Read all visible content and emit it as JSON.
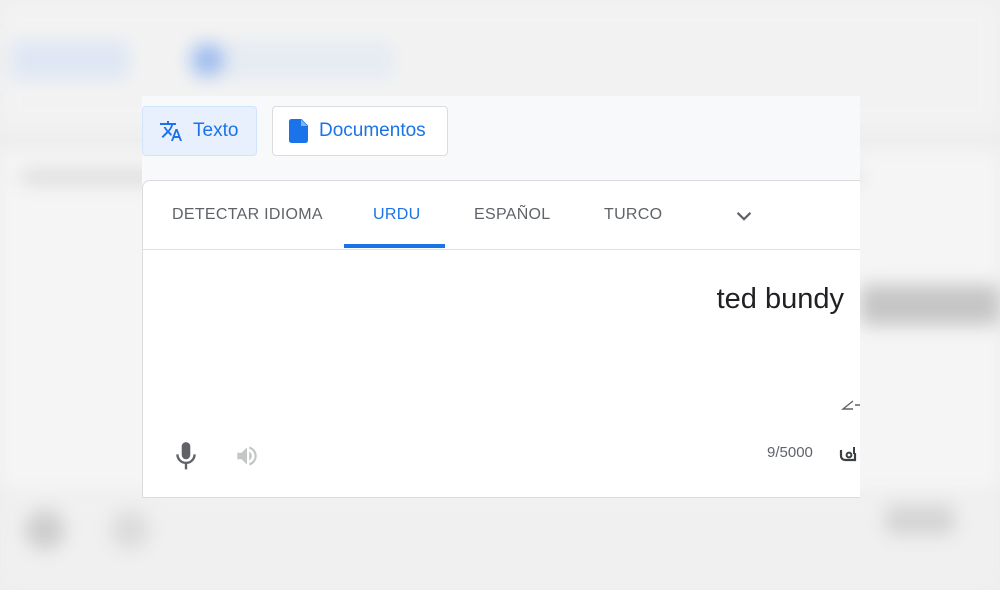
{
  "mode_buttons": {
    "text_label": "Texto",
    "documents_label": "Documentos"
  },
  "language_tabs": [
    {
      "label": "DETECTAR IDIOMA",
      "active": false
    },
    {
      "label": "URDU",
      "active": true
    },
    {
      "label": "ESPAÑOL",
      "active": false
    },
    {
      "label": "TURCO",
      "active": false
    }
  ],
  "source": {
    "text": "ted bundy",
    "char_count": "9/5000"
  },
  "icons": {
    "translate": "translate-icon",
    "document": "document-icon",
    "more_languages": "chevron-down-icon",
    "microphone": "microphone-icon",
    "listen": "speaker-icon",
    "handwriting": "handwriting-icon"
  },
  "colors": {
    "accent": "#1a73e8",
    "active_bg": "#e8f0fe",
    "text_muted": "#5f6368",
    "text_main": "#202124"
  }
}
